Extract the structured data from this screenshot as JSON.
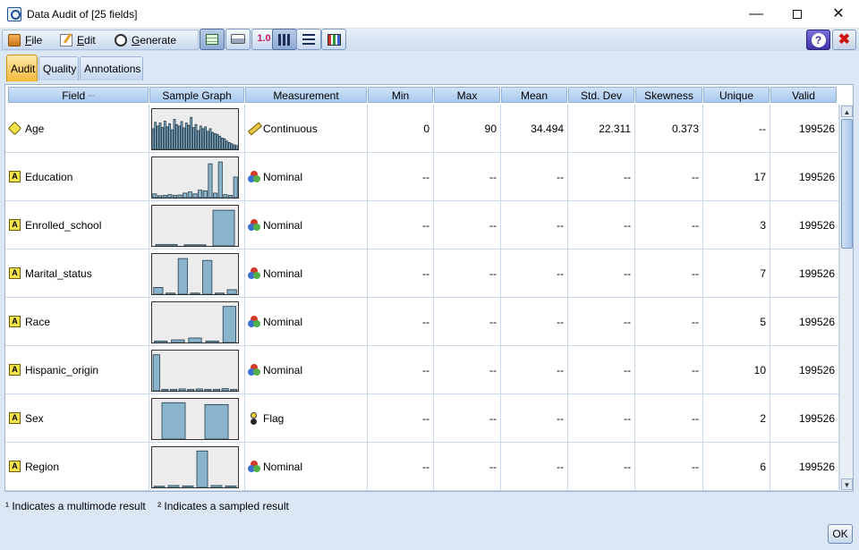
{
  "window": {
    "title": "Data Audit of [25 fields]"
  },
  "menu": {
    "file": "File",
    "file_key": "F",
    "file_rest": "ile",
    "edit_key": "E",
    "edit_rest": "dit",
    "generate_key": "G",
    "generate_rest": "enerate"
  },
  "tabs": [
    "Audit",
    "Quality",
    "Annotations"
  ],
  "active_tab": "Audit",
  "columns": [
    "Field",
    "Sample Graph",
    "Measurement",
    "Min",
    "Max",
    "Mean",
    "Std. Dev",
    "Skewness",
    "Unique",
    "Valid"
  ],
  "rows": [
    {
      "field": "Age",
      "type_icon": "continuous-diamond-icon",
      "measurement": "Continuous",
      "measure_icon": "ruler-icon",
      "min": "0",
      "max": "90",
      "mean": "34.494",
      "std_dev": "22.311",
      "skewness": "0.373",
      "unique": "--",
      "valid": "199526",
      "graph": {
        "kind": "histogram",
        "bars": [
          0.55,
          0.72,
          0.62,
          0.7,
          0.58,
          0.75,
          0.6,
          0.68,
          0.52,
          0.8,
          0.66,
          0.62,
          0.74,
          0.57,
          0.7,
          0.64,
          0.85,
          0.58,
          0.66,
          0.5,
          0.62,
          0.55,
          0.6,
          0.48,
          0.55,
          0.45,
          0.42,
          0.4,
          0.35,
          0.3,
          0.28,
          0.22,
          0.18,
          0.15,
          0.12,
          0.1
        ]
      }
    },
    {
      "field": "Education",
      "type_icon": "string-A-icon",
      "measurement": "Nominal",
      "measure_icon": "nominal-icon",
      "min": "--",
      "max": "--",
      "mean": "--",
      "std_dev": "--",
      "skewness": "--",
      "unique": "17",
      "valid": "199526",
      "graph": {
        "kind": "bars",
        "bars": [
          0.1,
          0.05,
          0.06,
          0.08,
          0.06,
          0.07,
          0.12,
          0.15,
          0.1,
          0.2,
          0.18,
          0.9,
          0.12,
          0.95,
          0.08,
          0.06,
          0.55
        ]
      }
    },
    {
      "field": "Enrolled_school",
      "type_icon": "string-A-icon",
      "measurement": "Nominal",
      "measure_icon": "nominal-icon",
      "min": "--",
      "max": "--",
      "mean": "--",
      "std_dev": "--",
      "skewness": "--",
      "unique": "3",
      "valid": "199526",
      "graph": {
        "kind": "bars",
        "bars": [
          0.04,
          0.03,
          0.95
        ]
      }
    },
    {
      "field": "Marital_status",
      "type_icon": "string-A-icon",
      "measurement": "Nominal",
      "measure_icon": "nominal-icon",
      "min": "--",
      "max": "--",
      "mean": "--",
      "std_dev": "--",
      "skewness": "--",
      "unique": "7",
      "valid": "199526",
      "graph": {
        "kind": "bars",
        "bars": [
          0.18,
          0.03,
          0.95,
          0.03,
          0.9,
          0.03,
          0.12
        ]
      }
    },
    {
      "field": "Race",
      "type_icon": "string-A-icon",
      "measurement": "Nominal",
      "measure_icon": "nominal-icon",
      "min": "--",
      "max": "--",
      "mean": "--",
      "std_dev": "--",
      "skewness": "--",
      "unique": "5",
      "valid": "199526",
      "graph": {
        "kind": "bars",
        "bars": [
          0.04,
          0.07,
          0.12,
          0.04,
          0.96
        ]
      }
    },
    {
      "field": "Hispanic_origin",
      "type_icon": "string-A-icon",
      "measurement": "Nominal",
      "measure_icon": "nominal-icon",
      "min": "--",
      "max": "--",
      "mean": "--",
      "std_dev": "--",
      "skewness": "--",
      "unique": "10",
      "valid": "199526",
      "graph": {
        "kind": "bars",
        "bars": [
          0.96,
          0.04,
          0.04,
          0.05,
          0.04,
          0.05,
          0.04,
          0.04,
          0.06,
          0.04
        ]
      }
    },
    {
      "field": "Sex",
      "type_icon": "string-A-icon",
      "measurement": "Flag",
      "measure_icon": "flag-icon",
      "min": "--",
      "max": "--",
      "mean": "--",
      "std_dev": "--",
      "skewness": "--",
      "unique": "2",
      "valid": "199526",
      "graph": {
        "kind": "bars",
        "bars": [
          0.97,
          0.92
        ]
      }
    },
    {
      "field": "Region",
      "type_icon": "string-A-icon",
      "measurement": "Nominal",
      "measure_icon": "nominal-icon",
      "min": "--",
      "max": "--",
      "mean": "--",
      "std_dev": "--",
      "skewness": "--",
      "unique": "6",
      "valid": "199526",
      "graph": {
        "kind": "bars",
        "bars": [
          0.03,
          0.05,
          0.04,
          0.97,
          0.05,
          0.04
        ]
      }
    }
  ],
  "footnotes": {
    "multimode": "¹ Indicates a multimode result",
    "sampled": "² Indicates a sampled result"
  },
  "ok_label": "OK",
  "colors": {
    "bar_fill": "#8ab4cc",
    "bar_stroke": "#22394a",
    "header": "#b9d4f2",
    "active_tab": "#f6b93b"
  }
}
